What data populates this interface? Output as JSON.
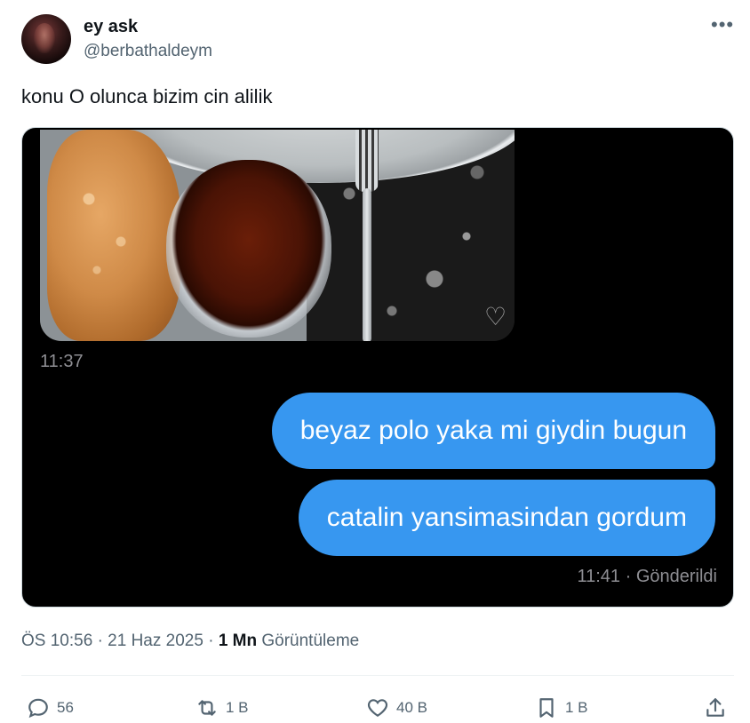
{
  "tweet": {
    "display_name": "ey ask",
    "handle": "@berbathaldeym",
    "more_label": "•••",
    "text": "konu O olunca bizim cin alilik"
  },
  "media": {
    "first_time": "11:37",
    "bubble1": "beyaz polo yaka mi giydin bugun",
    "bubble2": "catalin yansimasindan gordum",
    "sent_time": "11:41",
    "sent_status": "Gönderildi",
    "bubble_color": "#3797f0"
  },
  "meta": {
    "time": "ÖS 10:56",
    "date": "21 Haz 2025",
    "views_count": "1 Mn",
    "views_label": "Görüntüleme"
  },
  "actions": {
    "reply_count": "56",
    "retweet_count": "1 B",
    "like_count": "40 B",
    "bookmark_count": "1 B"
  }
}
